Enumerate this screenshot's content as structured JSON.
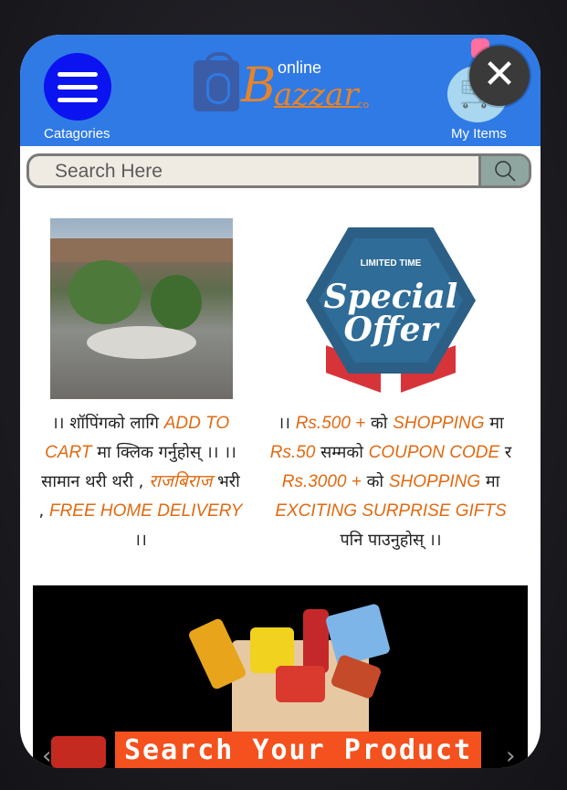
{
  "header": {
    "menu_label": "Catagories",
    "logo_small": "online",
    "logo_big_letter": "B",
    "logo_text": "azzar",
    "logo_suffix": ".co",
    "cart_label": "My Items",
    "close_symbol": "✕"
  },
  "search": {
    "placeholder": "Search Here",
    "icon": "search-icon"
  },
  "promos": [
    {
      "image_alt": "market square photo",
      "description": {
        "p1": "।। शॉपिंगको लागि ",
        "o1": "ADD TO CART",
        "p2": " मा क्लिक गर्नुहोस् ।। ।। सामान थरी थरी , ",
        "o2": "राजबिराज",
        "p3": " भरी , ",
        "o3": "FREE HOME DELIVERY",
        "p4": " ।।"
      }
    },
    {
      "badge_top": "LIMITED TIME",
      "badge_main_1": "Special",
      "badge_main_2": "Offer",
      "description": {
        "p1": "।। ",
        "o1": "Rs.500 +",
        "p2": " को ",
        "o2": "SHOPPING",
        "p3": " मा ",
        "o3": "Rs.50",
        "p4": " सम्मको ",
        "o4": "COUPON CODE",
        "p5": " र ",
        "o5": "Rs.3000 +",
        "p6": " को ",
        "o6": "SHOPPING",
        "p7": " मा ",
        "o7": "EXCITING SURPRISE GIFTS",
        "p8": " पनि पाउनुहोस् ।।"
      }
    }
  ],
  "banner": {
    "cta": "Search Your Product",
    "prev": "‹",
    "next": "›"
  },
  "colors": {
    "header_bg": "#2f7ae5",
    "menu_button": "#0b13f0",
    "accent_orange": "#e06a12",
    "cta_bg": "#f4511e"
  }
}
